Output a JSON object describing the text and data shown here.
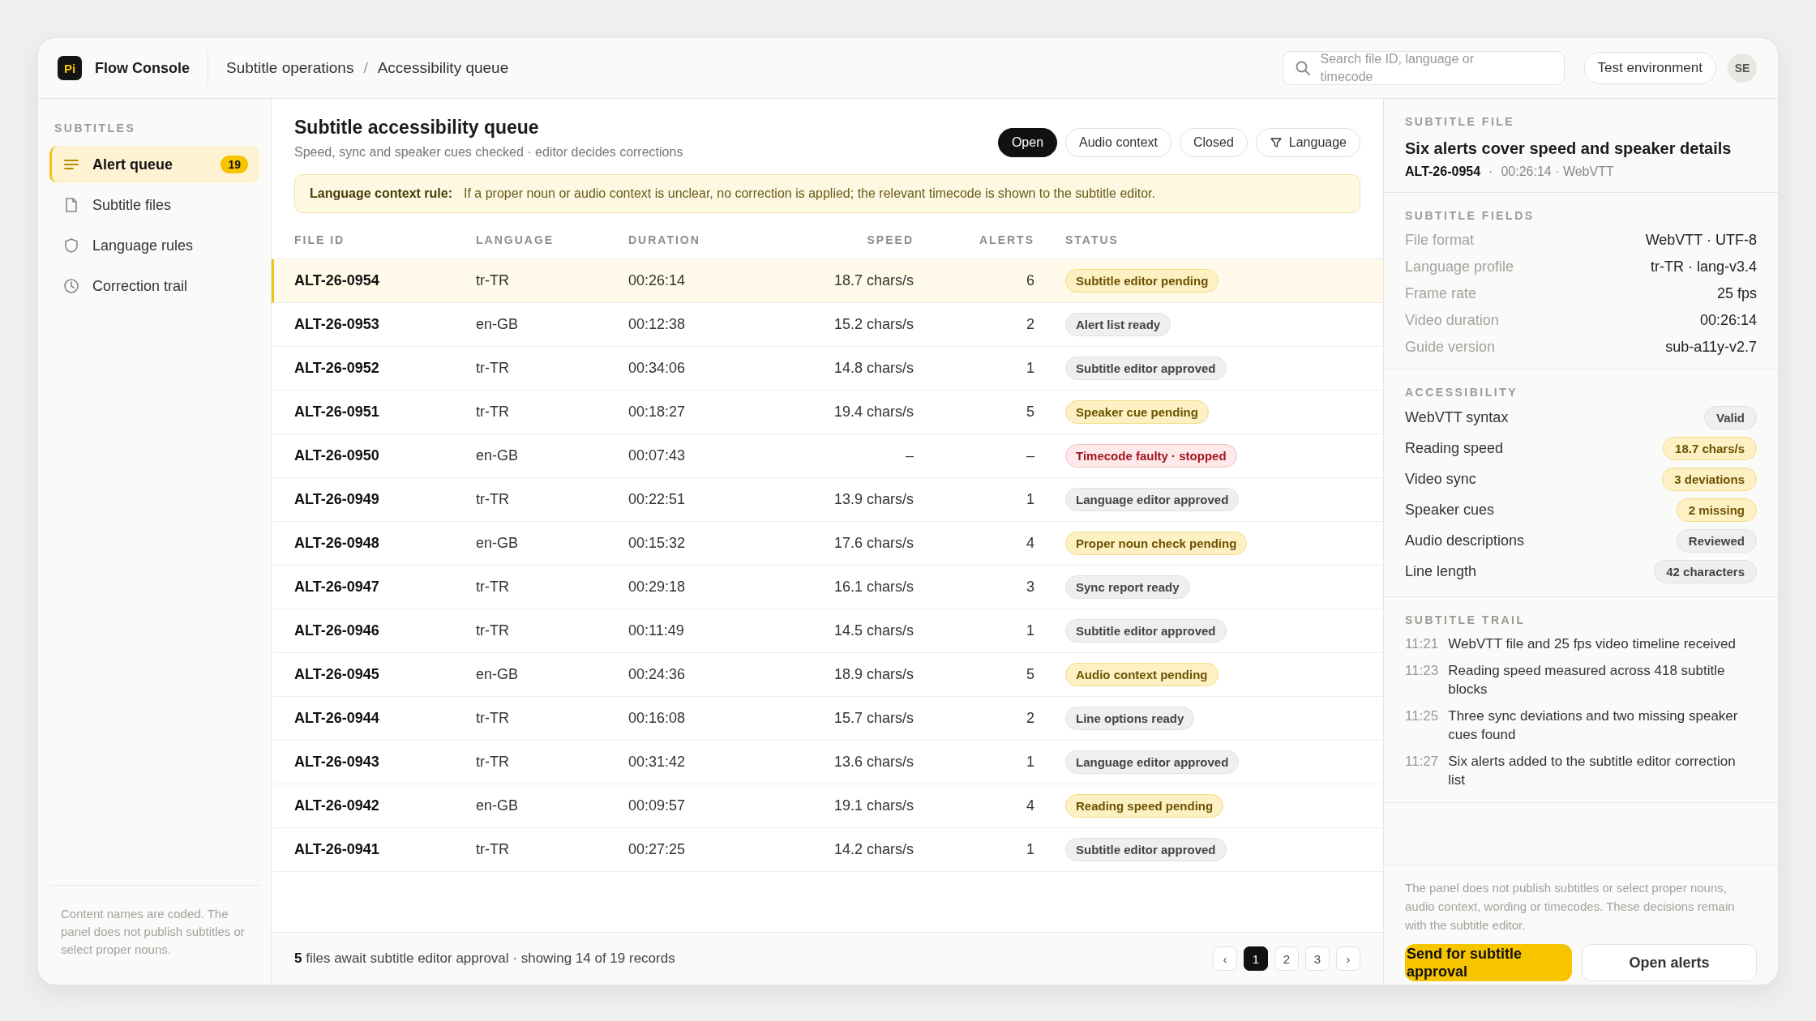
{
  "app": {
    "logo": "Pi",
    "name": "Flow Console"
  },
  "breadcrumb": [
    "Subtitle operations",
    "Accessibility queue"
  ],
  "breadcrumb_separator": "/",
  "search": {
    "placeholder": "Search file ID, language or timecode"
  },
  "environment_button": "Test environment",
  "avatar": "SE",
  "sidebar": {
    "heading": "SUBTITLES",
    "items": [
      {
        "label": "Alert queue",
        "selected": true,
        "count": "19"
      },
      {
        "label": "Subtitle files",
        "selected": false
      },
      {
        "label": "Language rules",
        "selected": false
      },
      {
        "label": "Correction trail",
        "selected": false
      }
    ],
    "note": "Content names are coded. The panel does not publish subtitles or select proper nouns."
  },
  "queue": {
    "title": "Subtitle accessibility queue",
    "subtitle": "Speed, sync and speaker cues checked · editor decides corrections",
    "filters": [
      {
        "label": "Open",
        "selected": true,
        "kind": "chip"
      },
      {
        "label": "Audio context",
        "selected": false,
        "kind": "chip"
      },
      {
        "label": "Closed",
        "selected": false,
        "kind": "chip"
      },
      {
        "label": "Language",
        "selected": false,
        "kind": "filter"
      }
    ],
    "rule": {
      "label": "Language context rule:",
      "text": "If a proper noun or audio context is unclear, no correction is applied; the relevant timecode is shown to the subtitle editor."
    },
    "table": {
      "columns": [
        "FILE ID",
        "LANGUAGE",
        "DURATION",
        "SPEED",
        "ALERTS",
        "STATUS"
      ],
      "rows": [
        {
          "file_id": "ALT-26-0954",
          "language": "tr-TR",
          "duration": "00:26:14",
          "speed": "18.7 chars/s",
          "alerts": "6",
          "status": "Subtitle editor pending",
          "color": "#6b5300",
          "selected": true
        },
        {
          "file_id": "ALT-26-0953",
          "language": "en-GB",
          "duration": "00:12:38",
          "speed": "15.2 chars/s",
          "alerts": "2",
          "status": "Alert list ready",
          "color": "#444444",
          "selected": false
        },
        {
          "file_id": "ALT-26-0952",
          "language": "tr-TR",
          "duration": "00:34:06",
          "speed": "14.8 chars/s",
          "alerts": "1",
          "status": "Subtitle editor approved",
          "color": "#444444",
          "selected": false
        },
        {
          "file_id": "ALT-26-0951",
          "language": "tr-TR",
          "duration": "00:18:27",
          "speed": "19.4 chars/s",
          "alerts": "5",
          "status": "Speaker cue pending",
          "color": "#6b5300",
          "selected": false
        },
        {
          "file_id": "ALT-26-0950",
          "language": "en-GB",
          "duration": "00:07:43",
          "speed": "–",
          "alerts": "–",
          "status": "Timecode faulty · stopped",
          "color": "#a3151c",
          "selected": false
        },
        {
          "file_id": "ALT-26-0949",
          "language": "tr-TR",
          "duration": "00:22:51",
          "speed": "13.9 chars/s",
          "alerts": "1",
          "status": "Language editor approved",
          "color": "#444444",
          "selected": false
        },
        {
          "file_id": "ALT-26-0948",
          "language": "en-GB",
          "duration": "00:15:32",
          "speed": "17.6 chars/s",
          "alerts": "4",
          "status": "Proper noun check pending",
          "color": "#6b5300",
          "selected": false
        },
        {
          "file_id": "ALT-26-0947",
          "language": "tr-TR",
          "duration": "00:29:18",
          "speed": "16.1 chars/s",
          "alerts": "3",
          "status": "Sync report ready",
          "color": "#444444",
          "selected": false
        },
        {
          "file_id": "ALT-26-0946",
          "language": "tr-TR",
          "duration": "00:11:49",
          "speed": "14.5 chars/s",
          "alerts": "1",
          "status": "Subtitle editor approved",
          "color": "#444444",
          "selected": false
        },
        {
          "file_id": "ALT-26-0945",
          "language": "en-GB",
          "duration": "00:24:36",
          "speed": "18.9 chars/s",
          "alerts": "5",
          "status": "Audio context pending",
          "color": "#6b5300",
          "selected": false
        },
        {
          "file_id": "ALT-26-0944",
          "language": "tr-TR",
          "duration": "00:16:08",
          "speed": "15.7 chars/s",
          "alerts": "2",
          "status": "Line options ready",
          "color": "#444444",
          "selected": false
        },
        {
          "file_id": "ALT-26-0943",
          "language": "tr-TR",
          "duration": "00:31:42",
          "speed": "13.6 chars/s",
          "alerts": "1",
          "status": "Language editor approved",
          "color": "#444444",
          "selected": false
        },
        {
          "file_id": "ALT-26-0942",
          "language": "en-GB",
          "duration": "00:09:57",
          "speed": "19.1 chars/s",
          "alerts": "4",
          "status": "Reading speed pending",
          "color": "#6b5300",
          "selected": false
        },
        {
          "file_id": "ALT-26-0941",
          "language": "tr-TR",
          "duration": "00:27:25",
          "speed": "14.2 chars/s",
          "alerts": "1",
          "status": "Subtitle editor approved",
          "color": "#444444",
          "selected": false
        }
      ]
    },
    "footer": {
      "summary": "**5** files await subtitle editor approval · showing 14 of 19 records",
      "previous": "‹",
      "pages": [
        {
          "label": "1",
          "selected": true
        },
        {
          "label": "2",
          "selected": false
        },
        {
          "label": "3",
          "selected": false
        }
      ],
      "next": "›"
    }
  },
  "detail": {
    "heading": "SUBTITLE FILE",
    "title": "Six alerts cover speed and speaker details",
    "file_id": "ALT-26-0954",
    "meta_separator": "·",
    "meta": "00:26:14 · WebVTT",
    "fields": {
      "heading": "SUBTITLE FIELDS",
      "rows": [
        {
          "label": "File format",
          "value": "WebVTT · UTF-8"
        },
        {
          "label": "Language profile",
          "value": "tr-TR · lang-v3.4"
        },
        {
          "label": "Frame rate",
          "value": "25 fps"
        },
        {
          "label": "Video duration",
          "value": "00:26:14"
        },
        {
          "label": "Guide version",
          "value": "sub-a11y-v2.7"
        }
      ]
    },
    "accessibility": {
      "heading": "ACCESSIBILITY",
      "rows": [
        {
          "label": "WebVTT syntax",
          "value": "Valid",
          "color": "#444444"
        },
        {
          "label": "Reading speed",
          "value": "18.7 chars/s",
          "color": "#6b5300"
        },
        {
          "label": "Video sync",
          "value": "3 deviations",
          "color": "#6b5300"
        },
        {
          "label": "Speaker cues",
          "value": "2 missing",
          "color": "#6b5300"
        },
        {
          "label": "Audio descriptions",
          "value": "Reviewed",
          "color": "#444444"
        },
        {
          "label": "Line length",
          "value": "42 characters",
          "color": "#444444"
        }
      ]
    },
    "trail": {
      "heading": "SUBTITLE TRAIL",
      "entries": [
        {
          "time": "11:21",
          "text": "WebVTT file and 25 fps video timeline received"
        },
        {
          "time": "11:23",
          "text": "Reading speed measured across 418 subtitle blocks"
        },
        {
          "time": "11:25",
          "text": "Three sync deviations and two missing speaker cues found"
        },
        {
          "time": "11:27",
          "text": "Six alerts added to the subtitle editor correction list"
        }
      ]
    },
    "note": "The panel does not publish subtitles or select proper nouns, audio context, wording or timecodes. These decisions remain with the subtitle editor.",
    "actions": [
      {
        "label": "Send for subtitle approval",
        "kind": "primary"
      },
      {
        "label": "Open alerts",
        "kind": "secondary"
      }
    ]
  }
}
